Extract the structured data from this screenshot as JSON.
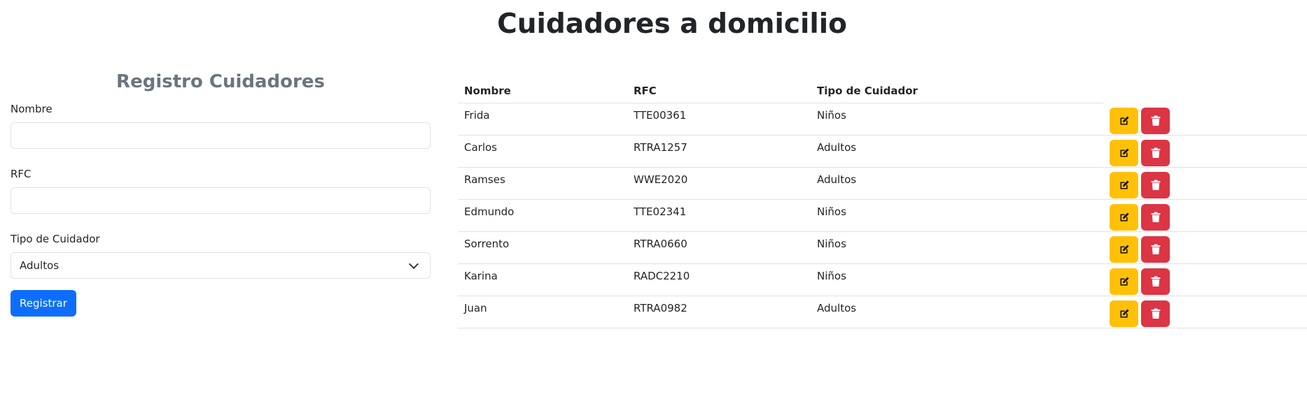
{
  "page": {
    "title": "Cuidadores a domicilio"
  },
  "form": {
    "title": "Registro Cuidadores",
    "nombre_label": "Nombre",
    "nombre_value": "",
    "rfc_label": "RFC",
    "rfc_value": "",
    "tipo_label": "Tipo de Cuidador",
    "tipo_selected": "Adultos",
    "submit_label": "Registrar"
  },
  "table": {
    "headers": [
      "Nombre",
      "RFC",
      "Tipo de Cuidador"
    ],
    "rows": [
      {
        "nombre": "Frida",
        "rfc": "TTE00361",
        "tipo": "Niños"
      },
      {
        "nombre": "Carlos",
        "rfc": "RTRA1257",
        "tipo": "Adultos"
      },
      {
        "nombre": "Ramses",
        "rfc": "WWE2020",
        "tipo": "Adultos"
      },
      {
        "nombre": "Edmundo",
        "rfc": "TTE02341",
        "tipo": "Niños"
      },
      {
        "nombre": "Sorrento",
        "rfc": "RTRA0660",
        "tipo": "Niños"
      },
      {
        "nombre": "Karina",
        "rfc": "RADC2210",
        "tipo": "Niños"
      },
      {
        "nombre": "Juan",
        "rfc": "RTRA0982",
        "tipo": "Adultos"
      }
    ],
    "row_actions": {
      "edit_icon": "edit-icon",
      "delete_icon": "trash-icon"
    }
  },
  "colors": {
    "primary": "#0d6efd",
    "warning": "#ffc107",
    "danger": "#dc3545",
    "muted": "#6c757d"
  }
}
